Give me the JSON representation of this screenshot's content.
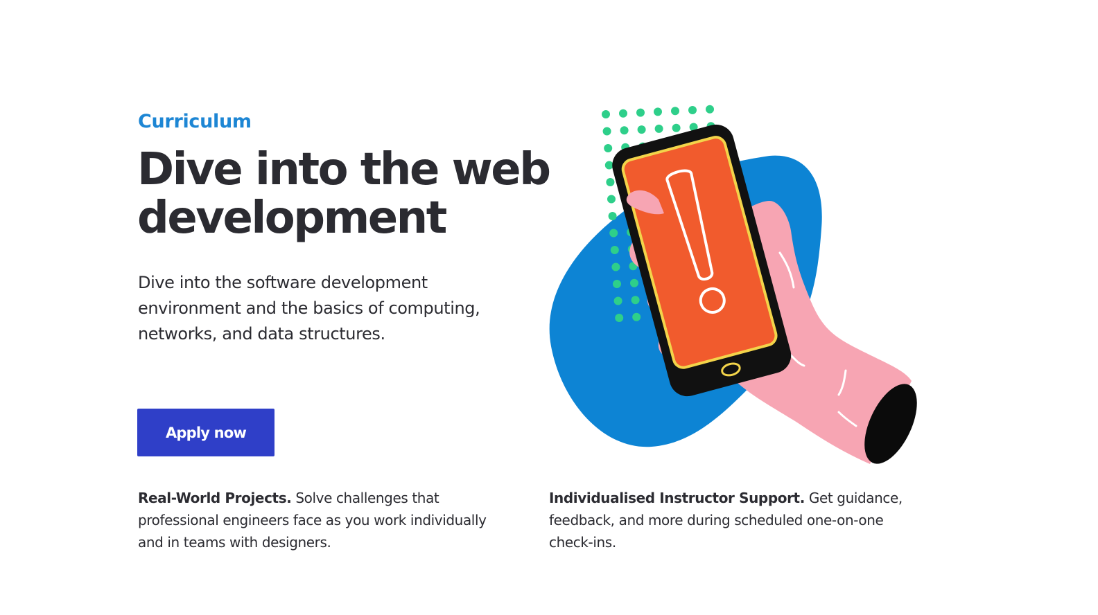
{
  "section": {
    "eyebrow": "Curriculum",
    "headline_line1": "Dive into the web",
    "headline_line2": "development",
    "lead": "Dive into the software development environment and the basics of computing, networks, and data structures.",
    "cta_label": "Apply now"
  },
  "features": [
    {
      "title": "Real-World Projects.",
      "body": " Solve challenges that professional engineers face as you work individually and in teams with designers."
    },
    {
      "title": "Individualised Instructor Support.",
      "body": " Get guidance, feedback, and more during scheduled one-on-one check-ins."
    }
  ],
  "illustration": {
    "icon": "hand-holding-phone-alert-illustration",
    "colors": {
      "blob": "#0d84d4",
      "dots": "#2ecf8a",
      "hand": "#f7a5b3",
      "phone_body": "#111111",
      "screen": "#f15b2d",
      "screen_border": "#f3d44a"
    }
  },
  "colors": {
    "accent": "#1d86d4",
    "button": "#2f3fc8",
    "text": "#2b2b31"
  }
}
